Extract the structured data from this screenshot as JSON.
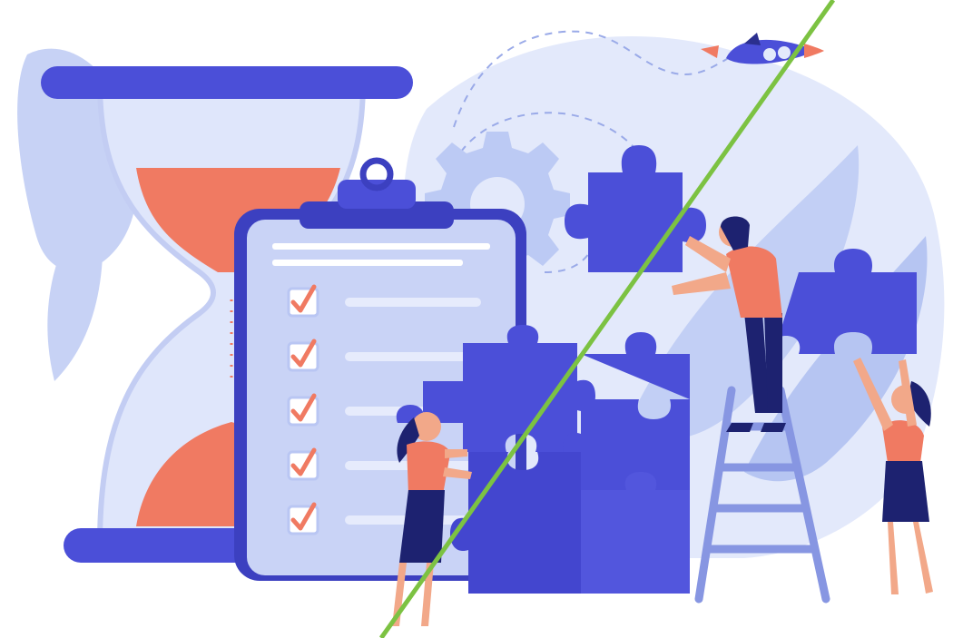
{
  "illustration": {
    "palette": {
      "indigo": "#4b4fd8",
      "indigo_dark": "#2b2f8f",
      "lavender": "#dfe6fb",
      "periwinkle": "#b9c6f3",
      "leaf": "#9fb2ee",
      "coral": "#f07a62",
      "skin": "#f2a889",
      "hair": "#1d2270",
      "clipboard": "#c9d3f6",
      "overlay_line": "#7cc242"
    },
    "icons": [
      "hourglass-icon",
      "clipboard-checklist-icon",
      "gear-icon",
      "rocket-icon",
      "puzzle-piece-icon",
      "ladder-icon",
      "person-icon"
    ],
    "checklist_checked": 5
  }
}
